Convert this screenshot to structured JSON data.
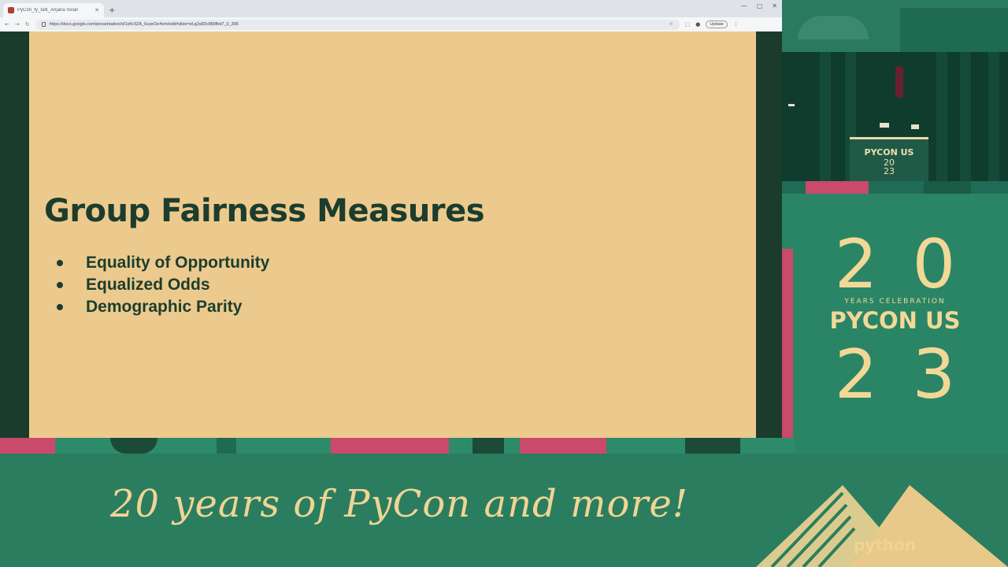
{
  "browser": {
    "tab_title": "PyCon_fy_talk_Anjana Sivan",
    "address": "https://docs.google.com/presentation/d/1xKr3ZA_6uyeOe4vm/edit#slide=id.g2a83c889fbd7_0_396",
    "update_label": "Update"
  },
  "slide": {
    "title": "Group Fairness Measures",
    "bullets": [
      "Equality of Opportunity",
      "Equalized Odds",
      "Demographic Parity"
    ]
  },
  "stage": {
    "podium_text": "PYCON US",
    "podium_year_top": "20",
    "podium_year_bottom": "23"
  },
  "event_logo": {
    "top": "20",
    "subtitle": "YEARS CELEBRATION",
    "name": "PYCON US",
    "bottom": "23"
  },
  "banner": {
    "tagline": "20 years of PyCon and more!",
    "sponsor": "python"
  },
  "colors": {
    "slide_background": "#ecca8d",
    "slide_text": "#1c3d2e",
    "frame_green": "#2b7d5f",
    "accent_pink": "#c94a6a",
    "logo_gold": "#f2d896"
  }
}
